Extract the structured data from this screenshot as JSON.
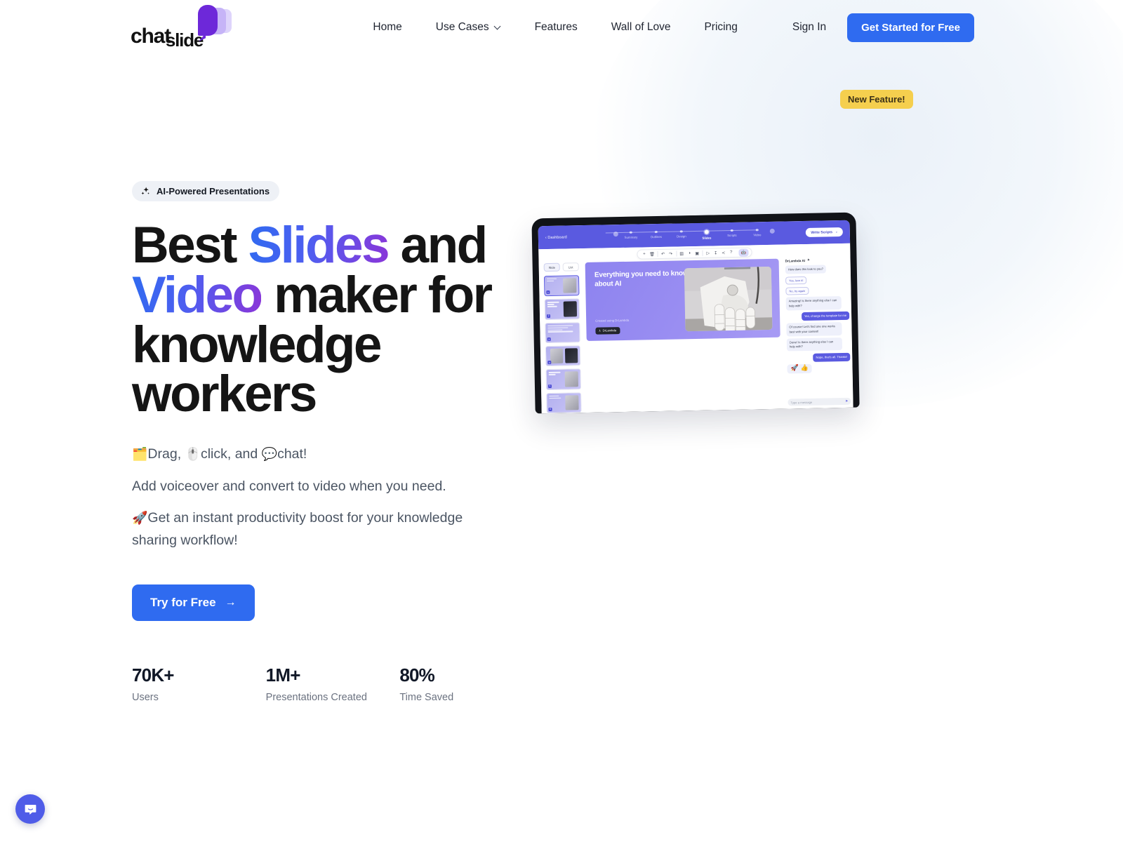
{
  "brand": {
    "wordmark_part1": "chat",
    "wordmark_part2": "slide",
    "accent_blue": "#2f6bf0",
    "accent_purple": "#6d28d9",
    "badge_yellow": "#f5cf4e"
  },
  "nav": {
    "items": [
      {
        "label": "Home",
        "has_chevron": false
      },
      {
        "label": "Use Cases",
        "has_chevron": true
      },
      {
        "label": "Features",
        "has_chevron": false
      },
      {
        "label": "Wall of Love",
        "has_chevron": false
      },
      {
        "label": "Pricing",
        "has_chevron": false
      }
    ],
    "sign_in": "Sign In",
    "cta": "Get Started  for Free"
  },
  "hero": {
    "badge": {
      "label": "AI-Powered Presentations",
      "icon": "sparkles-icon"
    },
    "title": {
      "line1_pre": "Best ",
      "line1_grad": "Slides",
      "line1_post": " and",
      "line2_grad": "Video",
      "line2_post": " maker for",
      "line3": "knowledge",
      "line4": "workers"
    },
    "sub_line1_emoji": "🗂️",
    "sub_line1": "Drag, ",
    "sub_line1_emoji2": "🖱️",
    "sub_line1b": "click, and ",
    "sub_line1_emoji3": "💬",
    "sub_line1c": "chat!",
    "sub_line2": "Add voiceover and convert to video when you need.",
    "sub_line3_emoji": "🚀",
    "sub_line3": "Get an instant productivity boost for your knowledge sharing workflow!",
    "cta": "Try for Free",
    "cta_arrow": "→",
    "stats": [
      {
        "value": "70K+",
        "label": "Users"
      },
      {
        "value": "1M+",
        "label": "Presentations Created"
      },
      {
        "value": "80%",
        "label": "Time Saved"
      }
    ],
    "new_feature_badge": "New Feature!"
  },
  "product_mock": {
    "back_label": "Dashboard",
    "steps": [
      {
        "label": "Summary",
        "state": "done"
      },
      {
        "label": "Outlines",
        "state": "done"
      },
      {
        "label": "Design",
        "state": "done"
      },
      {
        "label": "Slides",
        "state": "current"
      },
      {
        "label": "Scripts",
        "state": "todo"
      },
      {
        "label": "Video",
        "state": "locked"
      }
    ],
    "write_scripts": "Write Scripts",
    "write_scripts_arrow": "›",
    "toolbar_icons": [
      "add-icon",
      "delete-icon",
      "undo-icon",
      "redo-icon",
      "layout-icon",
      "theme-icon",
      "image-icon",
      "present-icon",
      "download-icon",
      "share-icon",
      "help-icon"
    ],
    "ai_icon": "ai-robot-icon",
    "rail_tabs": [
      {
        "label": "Slide",
        "active": true
      },
      {
        "label": "List",
        "active": false
      }
    ],
    "thumbnails": [
      {
        "num": "1",
        "kind": "photo",
        "selected": true
      },
      {
        "num": "2",
        "kind": "dark"
      },
      {
        "num": "3",
        "kind": "text"
      },
      {
        "num": "4",
        "kind": "triple"
      },
      {
        "num": "5",
        "kind": "photo"
      },
      {
        "num": "6",
        "kind": "photo"
      }
    ],
    "slide": {
      "title": "Everything you need to know about AI",
      "credit": "Created using DrLambda",
      "logo_chip": "DrLambda",
      "image_alt": "robot-hand-photo"
    },
    "chat": {
      "title": "DrLambda AI",
      "messages": [
        {
          "from": "bot",
          "text": "How does this look to you?"
        },
        {
          "from": "chip",
          "text": "Yes, love it!"
        },
        {
          "from": "chip",
          "text": "No, try again"
        },
        {
          "from": "bot",
          "text": "Amazing! Is there anything else I can help with?"
        },
        {
          "from": "user",
          "text": "Yes, change the template for me"
        },
        {
          "from": "bot",
          "text": "Of course! Let's find one one works best with your content!"
        },
        {
          "from": "bot",
          "text": "Done! Is there anything else I can help with?"
        },
        {
          "from": "user",
          "text": "Nope, that's all. Thanks!"
        },
        {
          "from": "reaction",
          "text": "🚀 👍"
        }
      ],
      "input_placeholder": "Type a message",
      "send_label": "➤"
    }
  },
  "widgets": {
    "intercom_label": "chat-launcher"
  }
}
